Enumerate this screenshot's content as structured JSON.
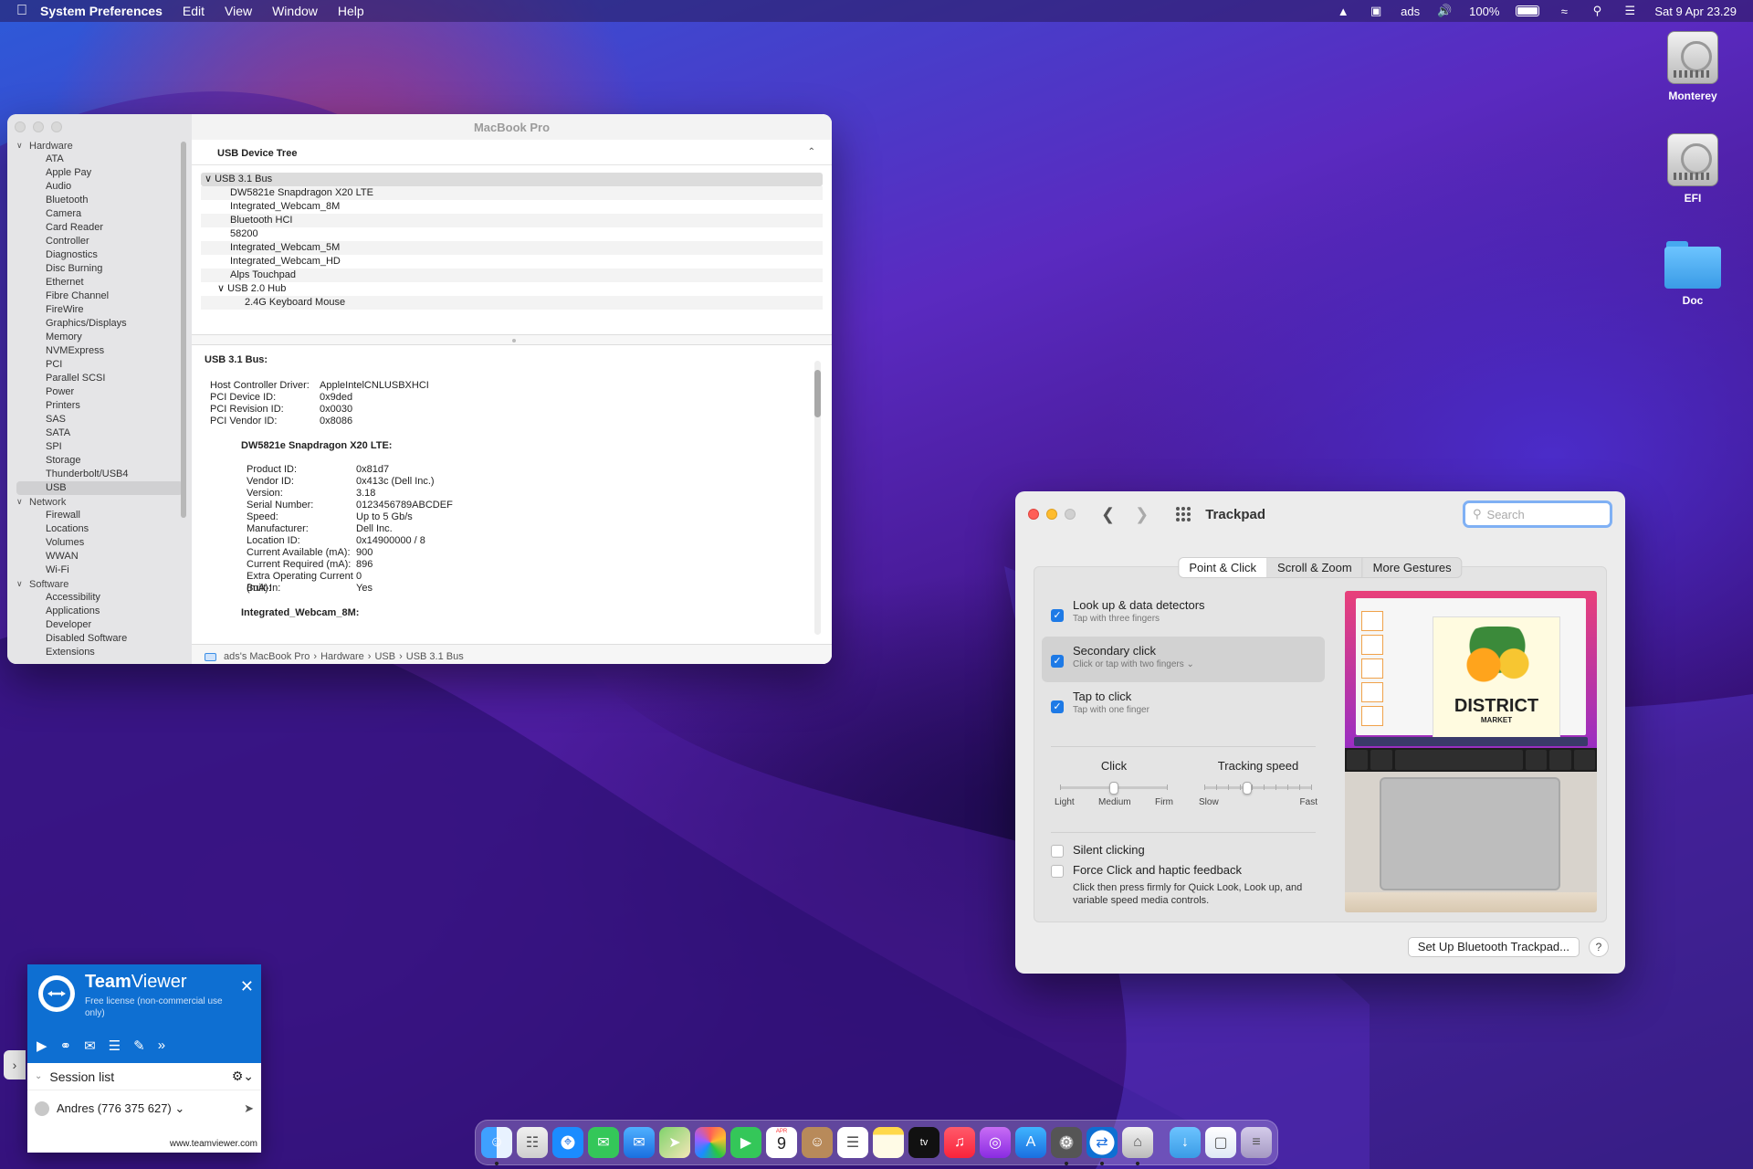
{
  "menubar": {
    "apple_icon": "apple-icon",
    "app_name": "System Preferences",
    "menus": [
      "Edit",
      "View",
      "Window",
      "Help"
    ],
    "user": "ads",
    "battery": "100%",
    "datetime": "Sat 9 Apr  23.29"
  },
  "desktop": {
    "icons": [
      "Monterey",
      "EFI",
      "Doc"
    ]
  },
  "sysinfo": {
    "title": "MacBook Pro",
    "sidebar": {
      "hardware": {
        "label": "Hardware",
        "items": [
          "ATA",
          "Apple Pay",
          "Audio",
          "Bluetooth",
          "Camera",
          "Card Reader",
          "Controller",
          "Diagnostics",
          "Disc Burning",
          "Ethernet",
          "Fibre Channel",
          "FireWire",
          "Graphics/Displays",
          "Memory",
          "NVMExpress",
          "PCI",
          "Parallel SCSI",
          "Power",
          "Printers",
          "SAS",
          "SATA",
          "SPI",
          "Storage",
          "Thunderbolt/USB4",
          "USB"
        ]
      },
      "network": {
        "label": "Network",
        "items": [
          "Firewall",
          "Locations",
          "Volumes",
          "WWAN",
          "Wi-Fi"
        ]
      },
      "software": {
        "label": "Software",
        "items": [
          "Accessibility",
          "Applications",
          "Developer",
          "Disabled Software",
          "Extensions"
        ]
      },
      "selected": "USB"
    },
    "tree_header": "USB Device Tree",
    "tree": {
      "bus": "USB 3.1 Bus",
      "devices": [
        "DW5821e Snapdragon X20 LTE",
        "Integrated_Webcam_8M",
        "Bluetooth HCI",
        "58200",
        "Integrated_Webcam_5M",
        "Integrated_Webcam_HD",
        "Alps Touchpad"
      ],
      "hub": "USB 2.0 Hub",
      "hub_devices": [
        "2.4G Keyboard Mouse"
      ]
    },
    "detail": {
      "bus_title": "USB 3.1 Bus:",
      "bus_props": [
        {
          "k": "Host Controller Driver:",
          "v": "AppleIntelCNLUSBXHCI"
        },
        {
          "k": "PCI Device ID:",
          "v": "0x9ded"
        },
        {
          "k": "PCI Revision ID:",
          "v": "0x0030"
        },
        {
          "k": "PCI Vendor ID:",
          "v": "0x8086"
        }
      ],
      "dev_title": "DW5821e Snapdragon X20 LTE:",
      "dev_props": [
        {
          "k": "Product ID:",
          "v": "0x81d7"
        },
        {
          "k": "Vendor ID:",
          "v": "0x413c  (Dell Inc.)"
        },
        {
          "k": "Version:",
          "v": "3.18"
        },
        {
          "k": "Serial Number:",
          "v": "0123456789ABCDEF"
        },
        {
          "k": "Speed:",
          "v": "Up to 5 Gb/s"
        },
        {
          "k": "Manufacturer:",
          "v": "Dell Inc."
        },
        {
          "k": "Location ID:",
          "v": "0x14900000 / 8"
        },
        {
          "k": "Current Available (mA):",
          "v": "900"
        },
        {
          "k": "Current Required (mA):",
          "v": "896"
        },
        {
          "k": "Extra Operating Current (mA):",
          "v": "0"
        },
        {
          "k": "Built-In:",
          "v": "Yes"
        }
      ],
      "dev2_title": "Integrated_Webcam_8M:"
    },
    "pathbar": [
      "ads's MacBook Pro",
      "Hardware",
      "USB",
      "USB 3.1 Bus"
    ]
  },
  "trackpad": {
    "title": "Trackpad",
    "search_placeholder": "Search",
    "tabs": [
      "Point & Click",
      "Scroll & Zoom",
      "More Gestures"
    ],
    "options": [
      {
        "title": "Look up & data detectors",
        "sub": "Tap with three fingers",
        "checked": true
      },
      {
        "title": "Secondary click",
        "sub": "Click or tap with two fingers ⌄",
        "checked": true
      },
      {
        "title": "Tap to click",
        "sub": "Tap with one finger",
        "checked": true
      }
    ],
    "click": {
      "label": "Click",
      "min": "Light",
      "mid": "Medium",
      "max": "Firm",
      "value": 0.5
    },
    "tracking": {
      "label": "Tracking speed",
      "min": "Slow",
      "max": "Fast",
      "value": 0.4
    },
    "silent": "Silent clicking",
    "force": "Force Click and haptic feedback",
    "force_desc": "Click then press firmly for Quick Look, Look up, and variable speed media controls.",
    "preview_brand": "DISTRICT",
    "preview_brand2": "MARKET",
    "bt_button": "Set Up Bluetooth Trackpad...",
    "help": "?"
  },
  "teamviewer": {
    "brand_a": "Team",
    "brand_b": "Viewer",
    "license": "Free license (non-commercial use only)",
    "session_list": "Session list",
    "contact": "Andres (776 375 627) ⌄",
    "footer": "www.teamviewer.com"
  },
  "dock": {
    "apps": [
      "finder-icon",
      "launchpad-icon",
      "safari-icon",
      "messages-icon",
      "mail-icon",
      "maps-icon",
      "photos-icon",
      "facetime-icon",
      "calendar-icon",
      "contacts-icon",
      "reminders-icon",
      "notes-icon",
      "tv-icon",
      "music-icon",
      "podcasts-icon",
      "app-store-icon",
      "system-preferences-icon",
      "teamviewer-icon",
      "system-information-icon",
      "downloads-folder-icon",
      "preview-icon",
      "trash-icon"
    ],
    "calendar_month": "APR",
    "calendar_day": "9",
    "tv_label": "tv"
  }
}
